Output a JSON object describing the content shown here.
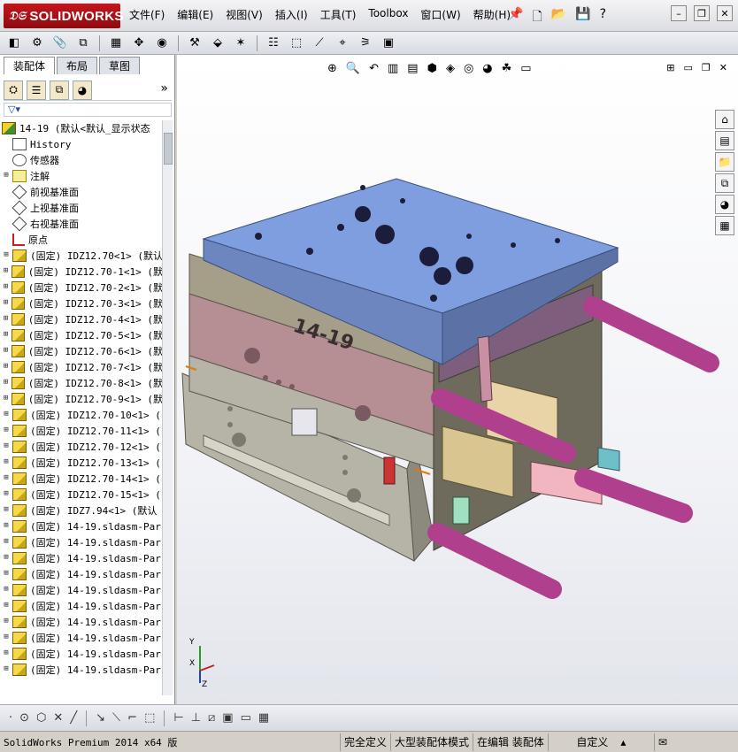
{
  "app": {
    "logo_brand": "SOLIDWORKS"
  },
  "menu": [
    "文件(F)",
    "编辑(E)",
    "视图(V)",
    "插入(I)",
    "工具(T)",
    "Toolbox",
    "窗口(W)",
    "帮助(H)"
  ],
  "tabs": [
    {
      "label": "装配体",
      "active": true
    },
    {
      "label": "布局",
      "active": false
    },
    {
      "label": "草图",
      "active": false
    }
  ],
  "tree": {
    "root": "14-19  (默认<默认_显示状态",
    "features": [
      {
        "label": "History",
        "icon": "history-icon"
      },
      {
        "label": "传感器",
        "icon": "sensor-icon"
      },
      {
        "label": "注解",
        "icon": "annotation-icon"
      },
      {
        "label": "前视基准面",
        "icon": "plane-icon"
      },
      {
        "label": "上视基准面",
        "icon": "plane-icon"
      },
      {
        "label": "右视基准面",
        "icon": "plane-icon"
      },
      {
        "label": "原点",
        "icon": "origin-icon"
      }
    ],
    "components": [
      "(固定) IDZ12.70<1> (默认",
      "(固定) IDZ12.70-1<1> (默",
      "(固定) IDZ12.70-2<1> (默",
      "(固定) IDZ12.70-3<1> (默",
      "(固定) IDZ12.70-4<1> (默",
      "(固定) IDZ12.70-5<1> (默",
      "(固定) IDZ12.70-6<1> (默",
      "(固定) IDZ12.70-7<1> (默",
      "(固定) IDZ12.70-8<1> (默",
      "(固定) IDZ12.70-9<1> (默",
      "(固定) IDZ12.70-10<1> (",
      "(固定) IDZ12.70-11<1> (",
      "(固定) IDZ12.70-12<1> (",
      "(固定) IDZ12.70-13<1> (",
      "(固定) IDZ12.70-14<1> (",
      "(固定) IDZ12.70-15<1> (",
      "(固定) IDZ7.94<1> (默认",
      "(固定) 14-19.sldasm-Par",
      "(固定) 14-19.sldasm-Par",
      "(固定) 14-19.sldasm-Par",
      "(固定) 14-19.sldasm-Par",
      "(固定) 14-19.sldasm-Par",
      "(固定) 14-19.sldasm-Par",
      "(固定) 14-19.sldasm-Par",
      "(固定) 14-19.sldasm-Par",
      "(固定) 14-19.sldasm-Par",
      "(固定) 14-19.sldasm-Par"
    ]
  },
  "model": {
    "engraved_text": "14-19"
  },
  "triad": {
    "x": "X",
    "y": "Y",
    "z": "Z"
  },
  "status": {
    "product": "SolidWorks Premium 2014 x64 版",
    "definition": "完全定义",
    "mode": "大型装配体模式",
    "editing": "在编辑 装配体",
    "custom": "自定义"
  },
  "colors": {
    "top_plate": "#7e9ee0",
    "mold_body": "#b68f95",
    "lower_body": "#b6b3a7",
    "guide_rods": "#b03f8e"
  }
}
